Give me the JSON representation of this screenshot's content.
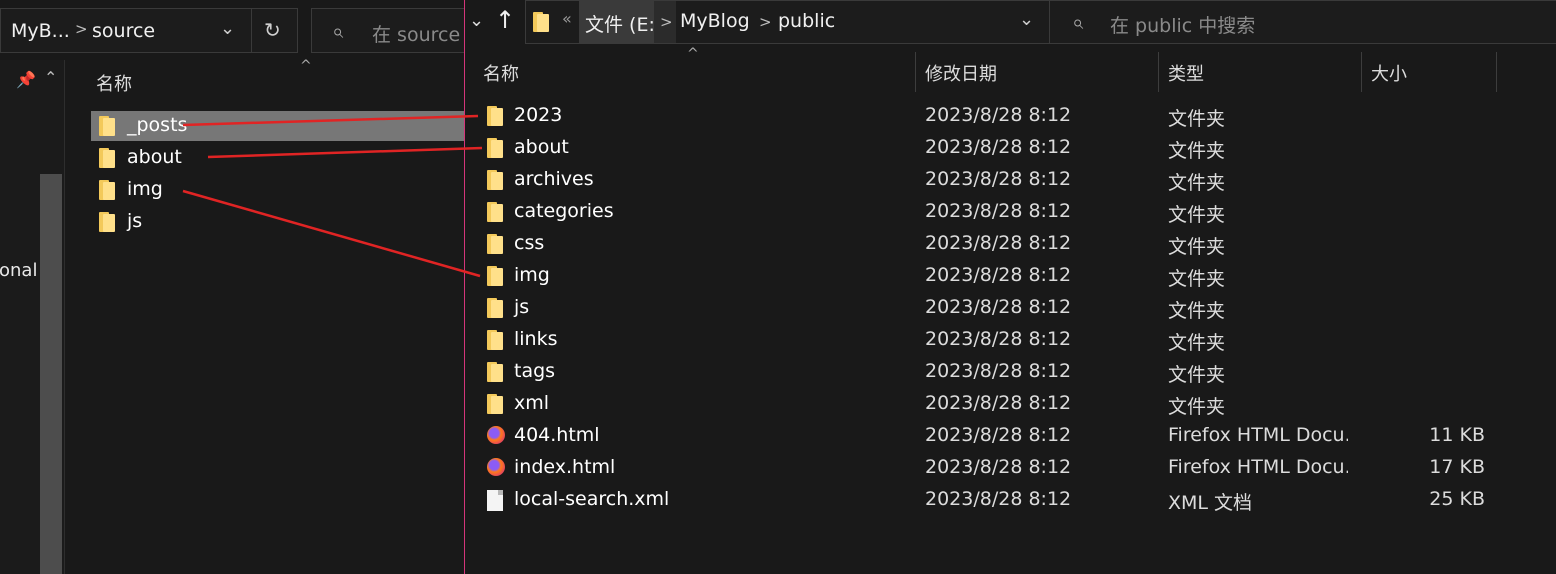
{
  "left_window": {
    "breadcrumb": [
      "MyB...",
      "source"
    ],
    "search_placeholder": "在 source 中搜索",
    "nav_partial_text": "onal",
    "column_header": "名称",
    "rows": [
      {
        "name": "_posts",
        "type": "folder",
        "selected": true
      },
      {
        "name": "about",
        "type": "folder",
        "selected": false
      },
      {
        "name": "img",
        "type": "folder",
        "selected": false
      },
      {
        "name": "js",
        "type": "folder",
        "selected": false
      }
    ]
  },
  "right_window": {
    "breadcrumb_drive": "文件 (E:)",
    "breadcrumb": [
      "MyBlog",
      "public"
    ],
    "search_placeholder": "在 public 中搜索",
    "columns": {
      "name": "名称",
      "date": "修改日期",
      "type": "类型",
      "size": "大小"
    },
    "rows": [
      {
        "name": "2023",
        "icon": "folder",
        "date": "2023/8/28 8:12",
        "type": "文件夹",
        "size": ""
      },
      {
        "name": "about",
        "icon": "folder",
        "date": "2023/8/28 8:12",
        "type": "文件夹",
        "size": ""
      },
      {
        "name": "archives",
        "icon": "folder",
        "date": "2023/8/28 8:12",
        "type": "文件夹",
        "size": ""
      },
      {
        "name": "categories",
        "icon": "folder",
        "date": "2023/8/28 8:12",
        "type": "文件夹",
        "size": ""
      },
      {
        "name": "css",
        "icon": "folder",
        "date": "2023/8/28 8:12",
        "type": "文件夹",
        "size": ""
      },
      {
        "name": "img",
        "icon": "folder",
        "date": "2023/8/28 8:12",
        "type": "文件夹",
        "size": ""
      },
      {
        "name": "js",
        "icon": "folder",
        "date": "2023/8/28 8:12",
        "type": "文件夹",
        "size": ""
      },
      {
        "name": "links",
        "icon": "folder",
        "date": "2023/8/28 8:12",
        "type": "文件夹",
        "size": ""
      },
      {
        "name": "tags",
        "icon": "folder",
        "date": "2023/8/28 8:12",
        "type": "文件夹",
        "size": ""
      },
      {
        "name": "xml",
        "icon": "folder",
        "date": "2023/8/28 8:12",
        "type": "文件夹",
        "size": ""
      },
      {
        "name": "404.html",
        "icon": "firefox",
        "date": "2023/8/28 8:12",
        "type": "Firefox HTML Docu...",
        "size": "11 KB"
      },
      {
        "name": "index.html",
        "icon": "firefox",
        "date": "2023/8/28 8:12",
        "type": "Firefox HTML Docu...",
        "size": "17 KB"
      },
      {
        "name": "local-search.xml",
        "icon": "document",
        "date": "2023/8/28 8:12",
        "type": "XML 文档",
        "size": "25 KB"
      }
    ]
  },
  "annotations": {
    "color": "#e02424",
    "links": [
      {
        "from": "_posts",
        "to": "2023"
      },
      {
        "from": "about",
        "to": "about"
      },
      {
        "from": "img",
        "to": "img"
      }
    ]
  },
  "colors": {
    "accent_border": "#d4357a",
    "selection": "#777777",
    "folder": "#f3c95a"
  }
}
